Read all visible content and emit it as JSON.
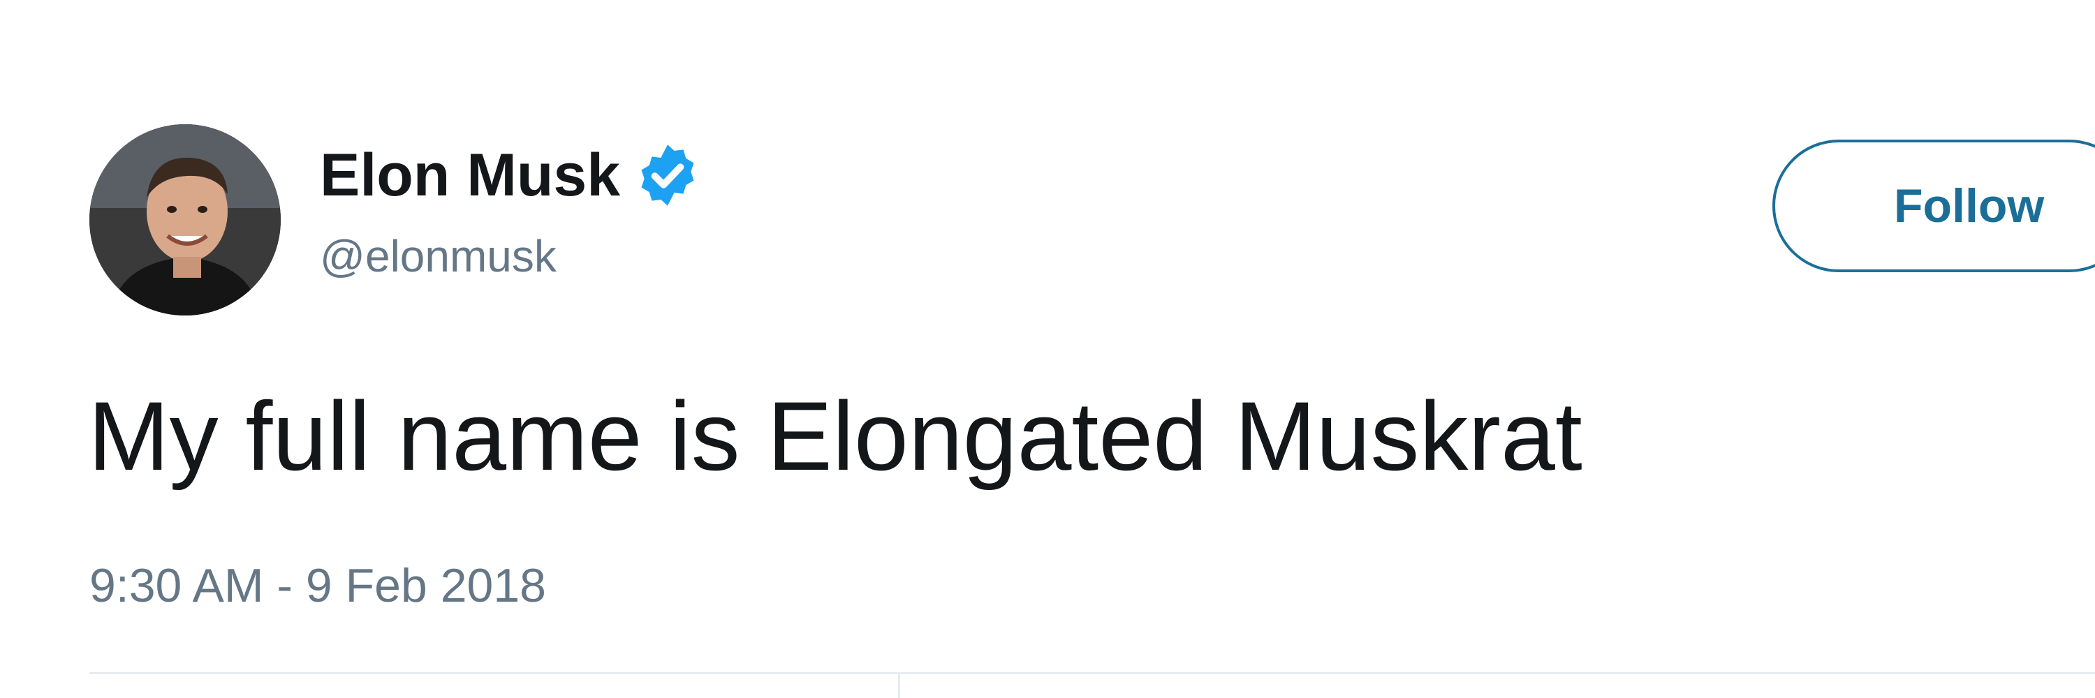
{
  "author": {
    "display_name": "Elon Musk",
    "handle": "@elonmusk",
    "verified": true,
    "verified_icon": "verified-badge-icon",
    "avatar": "profile-photo"
  },
  "follow_button": {
    "label": "Follow"
  },
  "tweet": {
    "text": "My full name is Elongated Muskrat",
    "timestamp": "9:30 AM - 9 Feb 2018"
  },
  "colors": {
    "accent": "#1b6e98",
    "verified_badge": "#1da1f2",
    "text_primary": "#14171a",
    "text_secondary": "#657786",
    "divider": "#e6ecf0"
  }
}
